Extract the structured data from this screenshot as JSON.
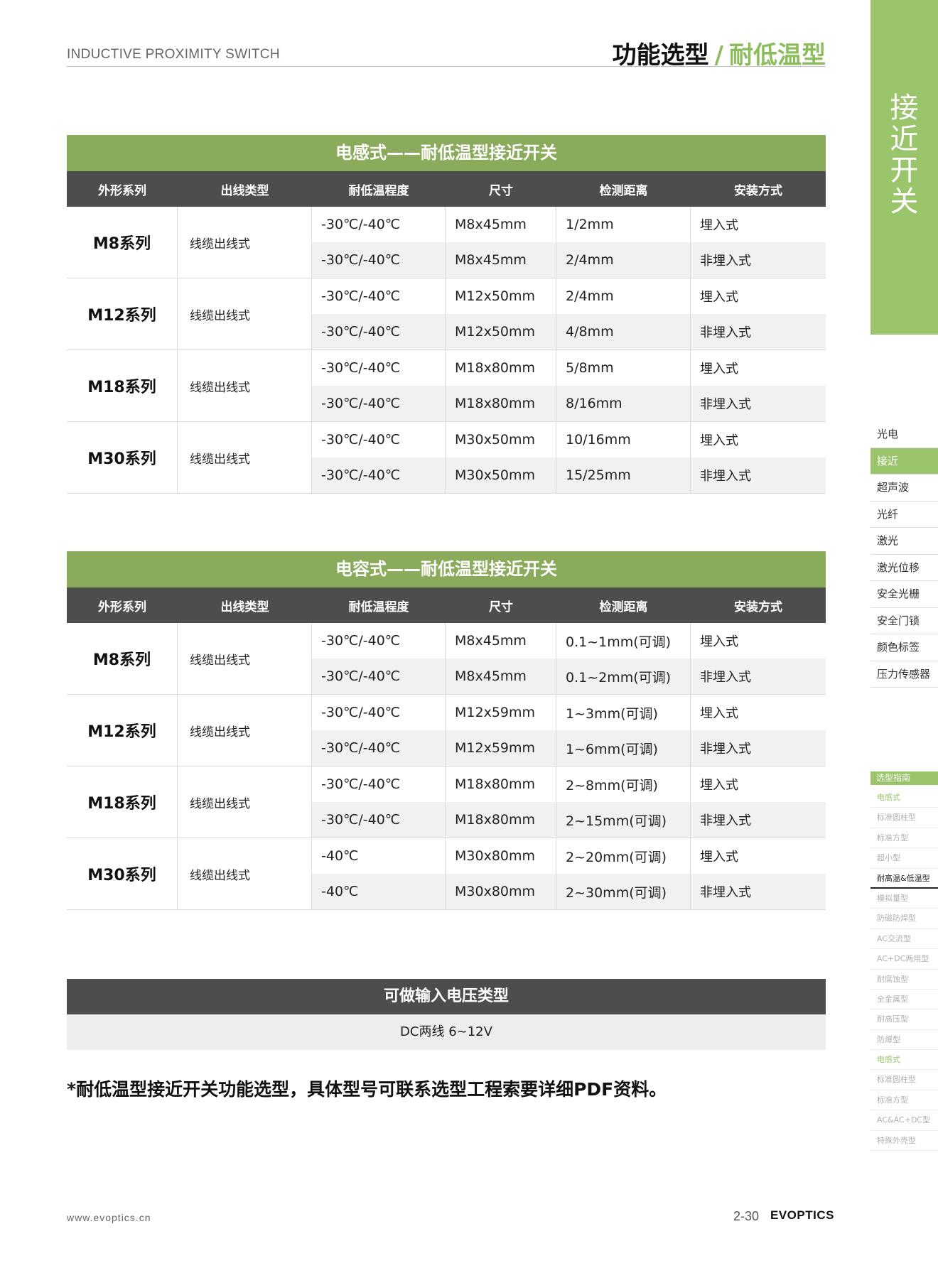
{
  "header": {
    "en_title": "INDUCTIVE PROXIMITY SWITCH",
    "title_main": "功能选型",
    "title_sep": "/",
    "title_sub": "耐低温型"
  },
  "side_band": {
    "label_chars": [
      "接",
      "近",
      "开",
      "关"
    ]
  },
  "category_nav": [
    {
      "label": "光电",
      "active": false
    },
    {
      "label": "接近",
      "active": true
    },
    {
      "label": "超声波",
      "active": false
    },
    {
      "label": "光纤",
      "active": false
    },
    {
      "label": "激光",
      "active": false
    },
    {
      "label": "激光位移",
      "active": false
    },
    {
      "label": "安全光栅",
      "active": false
    },
    {
      "label": "安全门锁",
      "active": false
    },
    {
      "label": "颜色标签",
      "active": false
    },
    {
      "label": "压力传感器",
      "active": false
    }
  ],
  "guide_nav": {
    "title": "选型指南",
    "items": [
      {
        "label": "电感式",
        "kind": "cat"
      },
      {
        "label": "标准圆柱型",
        "kind": "item"
      },
      {
        "label": "标准方型",
        "kind": "item"
      },
      {
        "label": "超小型",
        "kind": "item"
      },
      {
        "label": "耐高温&低温型",
        "kind": "active"
      },
      {
        "label": "模拟量型",
        "kind": "item"
      },
      {
        "label": "防磁防焊型",
        "kind": "item"
      },
      {
        "label": "AC交流型",
        "kind": "item"
      },
      {
        "label": "AC+DC两用型",
        "kind": "item"
      },
      {
        "label": "耐腐蚀型",
        "kind": "item"
      },
      {
        "label": "全金属型",
        "kind": "item"
      },
      {
        "label": "耐高压型",
        "kind": "item"
      },
      {
        "label": "防爆型",
        "kind": "item"
      },
      {
        "label": "电感式",
        "kind": "cat"
      },
      {
        "label": "标准圆柱型",
        "kind": "item"
      },
      {
        "label": "标准方型",
        "kind": "item"
      },
      {
        "label": "AC&AC+DC型",
        "kind": "item"
      },
      {
        "label": "特殊外壳型",
        "kind": "item"
      }
    ]
  },
  "columns": [
    "外形系列",
    "出线类型",
    "耐低温程度",
    "尺寸",
    "检测距离",
    "安装方式"
  ],
  "tables": [
    {
      "title": "电感式——耐低温型接近开关",
      "groups": [
        {
          "series": "M8系列",
          "wire": "线缆出线式",
          "rows": [
            {
              "temp": "-30℃/-40℃",
              "size": "M8x45mm",
              "dist": "1/2mm",
              "mount": "埋入式"
            },
            {
              "temp": "-30℃/-40℃",
              "size": "M8x45mm",
              "dist": "2/4mm",
              "mount": "非埋入式"
            }
          ]
        },
        {
          "series": "M12系列",
          "wire": "线缆出线式",
          "rows": [
            {
              "temp": "-30℃/-40℃",
              "size": "M12x50mm",
              "dist": "2/4mm",
              "mount": "埋入式"
            },
            {
              "temp": "-30℃/-40℃",
              "size": "M12x50mm",
              "dist": "4/8mm",
              "mount": "非埋入式"
            }
          ]
        },
        {
          "series": "M18系列",
          "wire": "线缆出线式",
          "rows": [
            {
              "temp": "-30℃/-40℃",
              "size": "M18x80mm",
              "dist": "5/8mm",
              "mount": "埋入式"
            },
            {
              "temp": "-30℃/-40℃",
              "size": "M18x80mm",
              "dist": "8/16mm",
              "mount": "非埋入式"
            }
          ]
        },
        {
          "series": "M30系列",
          "wire": "线缆出线式",
          "rows": [
            {
              "temp": "-30℃/-40℃",
              "size": "M30x50mm",
              "dist": "10/16mm",
              "mount": "埋入式"
            },
            {
              "temp": "-30℃/-40℃",
              "size": "M30x50mm",
              "dist": "15/25mm",
              "mount": "非埋入式"
            }
          ]
        }
      ]
    },
    {
      "title": "电容式——耐低温型接近开关",
      "groups": [
        {
          "series": "M8系列",
          "wire": "线缆出线式",
          "rows": [
            {
              "temp": "-30℃/-40℃",
              "size": "M8x45mm",
              "dist": "0.1~1mm(可调)",
              "mount": "埋入式"
            },
            {
              "temp": "-30℃/-40℃",
              "size": "M8x45mm",
              "dist": "0.1~2mm(可调)",
              "mount": "非埋入式"
            }
          ]
        },
        {
          "series": "M12系列",
          "wire": "线缆出线式",
          "rows": [
            {
              "temp": "-30℃/-40℃",
              "size": "M12x59mm",
              "dist": "1~3mm(可调)",
              "mount": "埋入式"
            },
            {
              "temp": "-30℃/-40℃",
              "size": "M12x59mm",
              "dist": "1~6mm(可调)",
              "mount": "非埋入式"
            }
          ]
        },
        {
          "series": "M18系列",
          "wire": "线缆出线式",
          "rows": [
            {
              "temp": "-30℃/-40℃",
              "size": "M18x80mm",
              "dist": "2~8mm(可调)",
              "mount": "埋入式"
            },
            {
              "temp": "-30℃/-40℃",
              "size": "M18x80mm",
              "dist": "2~15mm(可调)",
              "mount": "非埋入式"
            }
          ]
        },
        {
          "series": "M30系列",
          "wire": "线缆出线式",
          "rows": [
            {
              "temp": "-40℃",
              "size": "M30x80mm",
              "dist": "2~20mm(可调)",
              "mount": "埋入式"
            },
            {
              "temp": "-40℃",
              "size": "M30x80mm",
              "dist": "2~30mm(可调)",
              "mount": "非埋入式"
            }
          ]
        }
      ]
    }
  ],
  "voltage": {
    "title": "可做输入电压类型",
    "value": "DC两线 6~12V"
  },
  "note": "*耐低温型接近开关功能选型，具体型号可联系选型工程索要详细PDF资料。",
  "footer": {
    "url": "www.evoptics.cn",
    "page": "2-30",
    "brand": "EVOPTICS"
  }
}
